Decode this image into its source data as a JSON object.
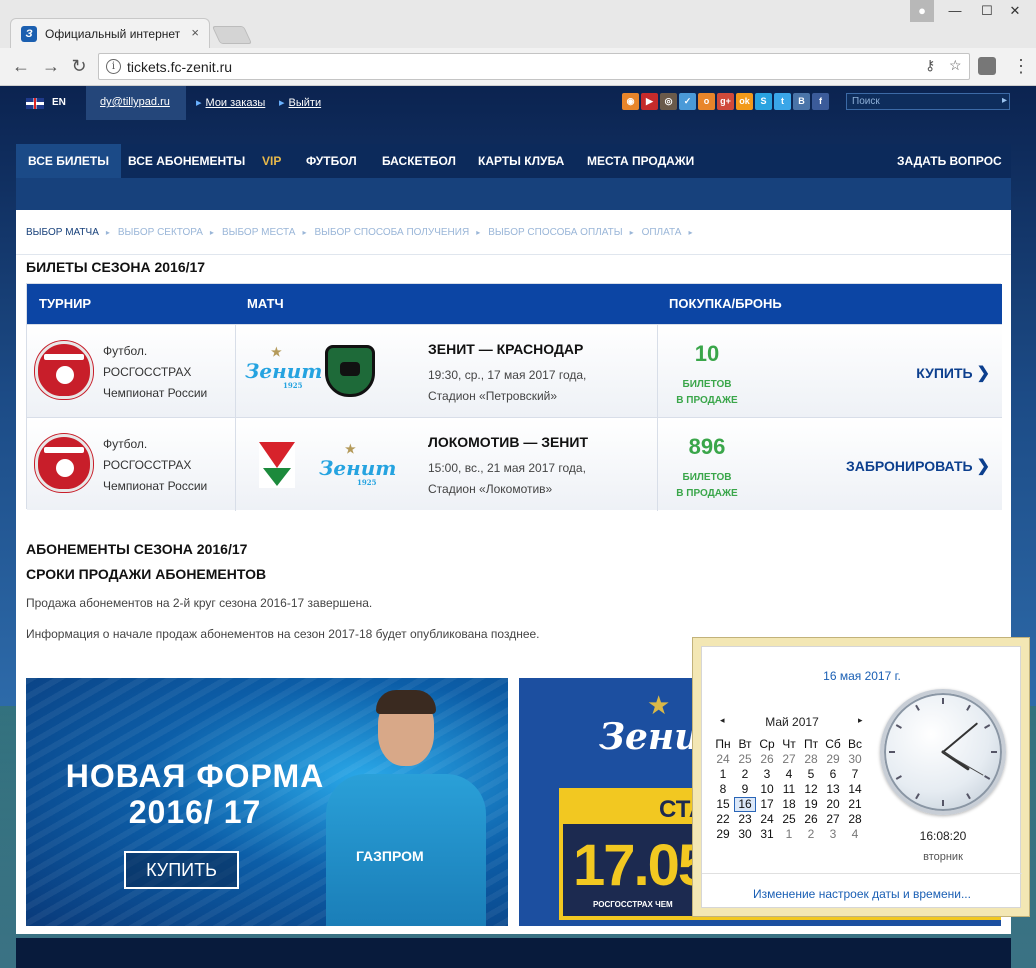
{
  "browser": {
    "tab_title": "Официальный интернет",
    "tab_close": "×",
    "url": "tickets.fc-zenit.ru",
    "nav_back": "←",
    "nav_forward": "→",
    "nav_reload": "↻",
    "info_icon": "i",
    "menu_icon": "⋮",
    "bookmark_icon": "☆",
    "window_min": "—",
    "window_max": "☐",
    "window_close": "✕"
  },
  "topbar": {
    "lang": "EN",
    "email": "dy@tillypad.ru",
    "orders": "Мои заказы",
    "logout": "Выйти",
    "search_placeholder": "Поиск",
    "search_go": "▸",
    "social": [
      {
        "name": "rss",
        "color": "#e8852a",
        "glyph": "◉"
      },
      {
        "name": "youtube",
        "color": "#c62b2b",
        "glyph": "▶"
      },
      {
        "name": "instagram",
        "color": "#6a5a4a",
        "glyph": "◎"
      },
      {
        "name": "checkin",
        "color": "#4a9ad8",
        "glyph": "✓"
      },
      {
        "name": "odnoklassniki",
        "color": "#e8852a",
        "glyph": "о"
      },
      {
        "name": "googleplus",
        "color": "#d04a3a",
        "glyph": "g+"
      },
      {
        "name": "ok",
        "color": "#f29a1a",
        "glyph": "ok"
      },
      {
        "name": "skype",
        "color": "#29a3e0",
        "glyph": "S"
      },
      {
        "name": "twitter",
        "color": "#3aa6e8",
        "glyph": "t"
      },
      {
        "name": "vk",
        "color": "#4a74a8",
        "glyph": "В"
      },
      {
        "name": "facebook",
        "color": "#3b5b9a",
        "glyph": "f"
      }
    ]
  },
  "nav": {
    "items": [
      "ВСЕ БИЛЕТЫ",
      "ВСЕ АБОНЕМЕНТЫ",
      "VIP",
      "ФУТБОЛ",
      "БАСКЕТБОЛ",
      "КАРТЫ КЛУБА",
      "МЕСТА ПРОДАЖИ"
    ],
    "ask": "ЗАДАТЬ ВОПРОС"
  },
  "breadcrumbs": [
    "ВЫБОР МАТЧА",
    "ВЫБОР СЕКТОРА",
    "ВЫБОР МЕСТА",
    "ВЫБОР СПОСОБА ПОЛУЧЕНИЯ",
    "ВЫБОР СПОСОБА ОПЛАТЫ",
    "ОПЛАТА"
  ],
  "season_title": "БИЛЕТЫ СЕЗОНА 2016/17",
  "table": {
    "headers": {
      "tournament": "ТУРНИР",
      "match": "МАТЧ",
      "purchase": "ПОКУПКА/БРОНЬ"
    },
    "rows": [
      {
        "tournament_l1": "Футбол.",
        "tournament_l2": "РОСГОССТРАХ",
        "tournament_l3": "Чемпионат России",
        "title": "ЗЕНИТ — КРАСНОДАР",
        "datetime": "19:30, ср., 17 мая 2017 года,",
        "venue": "Стадион «Петровский»",
        "count": "10",
        "count_l1": "БИЛЕТОВ",
        "count_l2": "В ПРОДАЖЕ",
        "action": "КУПИТЬ"
      },
      {
        "tournament_l1": "Футбол.",
        "tournament_l2": "РОСГОССТРАХ",
        "tournament_l3": "Чемпионат России",
        "title": "ЛОКОМОТИВ — ЗЕНИТ",
        "datetime": "15:00, вс., 21 мая 2017 года,",
        "venue": "Стадион «Локомотив»",
        "count": "896",
        "count_l1": "БИЛЕТОВ",
        "count_l2": "В ПРОДАЖЕ",
        "action": "ЗАБРОНИРОВАТЬ"
      }
    ]
  },
  "zenit_logo": {
    "text": "Зенит",
    "year": "1925",
    "star": "★"
  },
  "subscriptions": {
    "title": "АБОНЕМЕНТЫ СЕЗОНА 2016/17",
    "subtitle": "СРОКИ ПРОДАЖИ АБОНЕМЕНТОВ",
    "p1": "Продажа абонементов на 2-й круг сезона 2016-17 завершена.",
    "p2": "Информация о начале продаж абонементов на сезон 2017-18 будет опубликована позднее."
  },
  "banner1": {
    "line1": "НОВАЯ ФОРМА",
    "line2": "2016/ 17",
    "button": "КУПИТЬ",
    "sponsor": "ГАЗПРОМ"
  },
  "banner2": {
    "star": "★",
    "logo": "Зенит",
    "stad": "СТАД",
    "date": "17.05",
    "small": "РОСГОССТРАХ ЧЕМ"
  },
  "calendar": {
    "today_label": "16 мая 2017 г.",
    "month": "Май 2017",
    "prev": "◂",
    "next": "▸",
    "weekdays": [
      "Пн",
      "Вт",
      "Ср",
      "Чт",
      "Пт",
      "Сб",
      "Вс"
    ],
    "lead_days": [
      "24",
      "25",
      "26",
      "27",
      "28",
      "29",
      "30"
    ],
    "days": [
      "1",
      "2",
      "3",
      "4",
      "5",
      "6",
      "7",
      "8",
      "9",
      "10",
      "11",
      "12",
      "13",
      "14",
      "15",
      "16",
      "17",
      "18",
      "19",
      "20",
      "21",
      "22",
      "23",
      "24",
      "25",
      "26",
      "27",
      "28",
      "29",
      "30",
      "31"
    ],
    "trail_days": [
      "1",
      "2",
      "3",
      "4"
    ],
    "today": 16,
    "time": "16:08:20",
    "weekday": "вторник",
    "settings_link": "Изменение настроек даты и времени..."
  }
}
